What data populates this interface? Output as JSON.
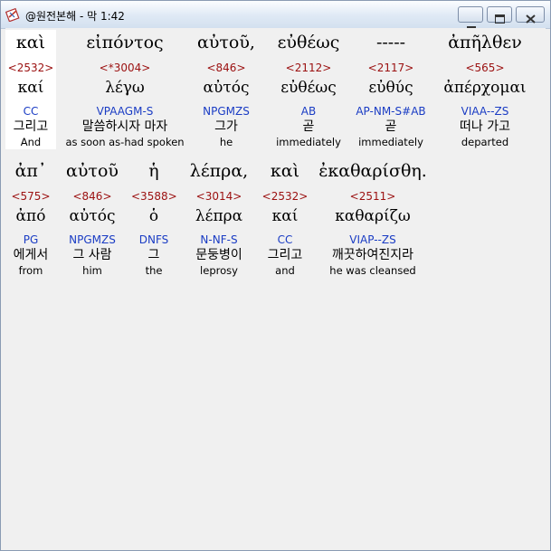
{
  "window": {
    "title": "@원전본해 - 막 1:42",
    "minimize_icon": "minimize-icon",
    "maximize_icon": "maximize-icon",
    "close_icon": "close-icon"
  },
  "lines": [
    {
      "words": [
        {
          "greek": "καὶ",
          "strong": "<2532>",
          "lemma": "καί",
          "morph": "CC",
          "korean": "그리고",
          "english": "And"
        },
        {
          "greek": "εἰπόντος",
          "strong": "<*3004>",
          "lemma": "λέγω",
          "morph": "VPAAGM-S",
          "korean": "말씀하시자 마자",
          "english": "as soon as-had spoken"
        },
        {
          "greek": "αὐτοῦ,",
          "strong": "<846>",
          "lemma": "αὐτός",
          "morph": "NPGMZS",
          "korean": "그가",
          "english": "he"
        },
        {
          "greek": "εὐθέως",
          "strong": "<2112>",
          "lemma": "εὐθέως",
          "morph": "AB",
          "korean": "곧",
          "english": "immediately"
        },
        {
          "greek": "-----",
          "strong": "<2117>",
          "lemma": "εὐθύς",
          "morph": "AP-NM-S#AB",
          "korean": "곧",
          "english": "immediately"
        },
        {
          "greek": "ἀπῆλθεν",
          "strong": "<565>",
          "lemma": "ἀπέρχομαι",
          "morph": "VIAA--ZS",
          "korean": "떠나 가고",
          "english": "departed"
        }
      ]
    },
    {
      "words": [
        {
          "greek": "ἀπ᾽",
          "strong": "<575>",
          "lemma": "ἀπό",
          "morph": "PG",
          "korean": "에게서",
          "english": "from"
        },
        {
          "greek": "αὐτοῦ",
          "strong": "<846>",
          "lemma": "αὐτός",
          "morph": "NPGMZS",
          "korean": "그 사람",
          "english": "him"
        },
        {
          "greek": "ἡ",
          "strong": "<3588>",
          "lemma": "ὁ",
          "morph": "DNFS",
          "korean": "그",
          "english": "the"
        },
        {
          "greek": "λέπρα,",
          "strong": "<3014>",
          "lemma": "λέπρα",
          "morph": "N-NF-S",
          "korean": "문둥병이",
          "english": "leprosy"
        },
        {
          "greek": "καὶ",
          "strong": "<2532>",
          "lemma": "καί",
          "morph": "CC",
          "korean": "그리고",
          "english": "and"
        },
        {
          "greek": "ἐκαθαρίσθη.",
          "strong": "<2511>",
          "lemma": "καθαρίζω",
          "morph": "VIAP--ZS",
          "korean": "깨끗하여진지라",
          "english": "he was cleansed"
        }
      ]
    }
  ]
}
